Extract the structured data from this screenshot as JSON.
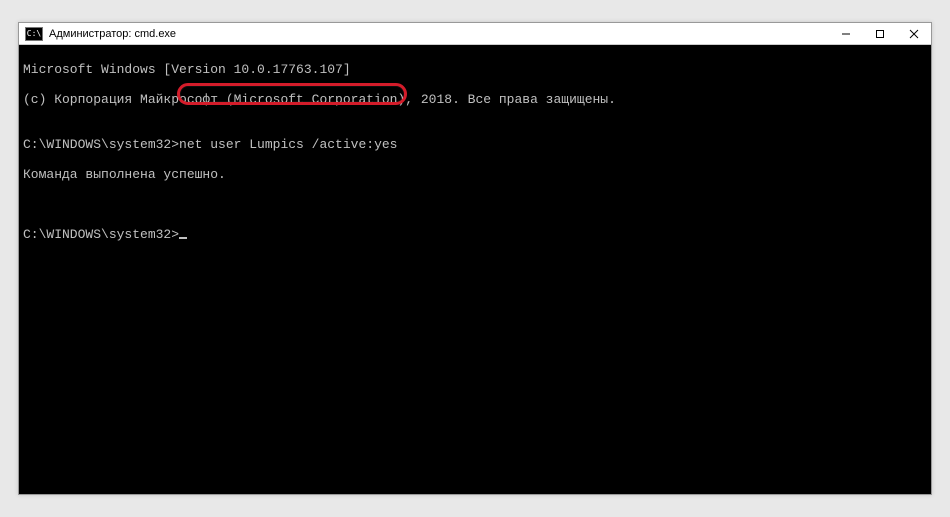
{
  "window": {
    "title": "Администратор: cmd.exe",
    "icon_text": "C:\\"
  },
  "console": {
    "line1": "Microsoft Windows [Version 10.0.17763.107]",
    "line2": "(c) Корпорация Майкрософт (Microsoft Corporation), 2018. Все права защищены.",
    "blank1": "",
    "prompt1_path": "C:\\WINDOWS\\system32>",
    "prompt1_cmd": "net user Lumpics /active:yes",
    "result": "Команда выполнена успешно.",
    "blank2": "",
    "blank3": "",
    "prompt2_path": "C:\\WINDOWS\\system32>"
  }
}
